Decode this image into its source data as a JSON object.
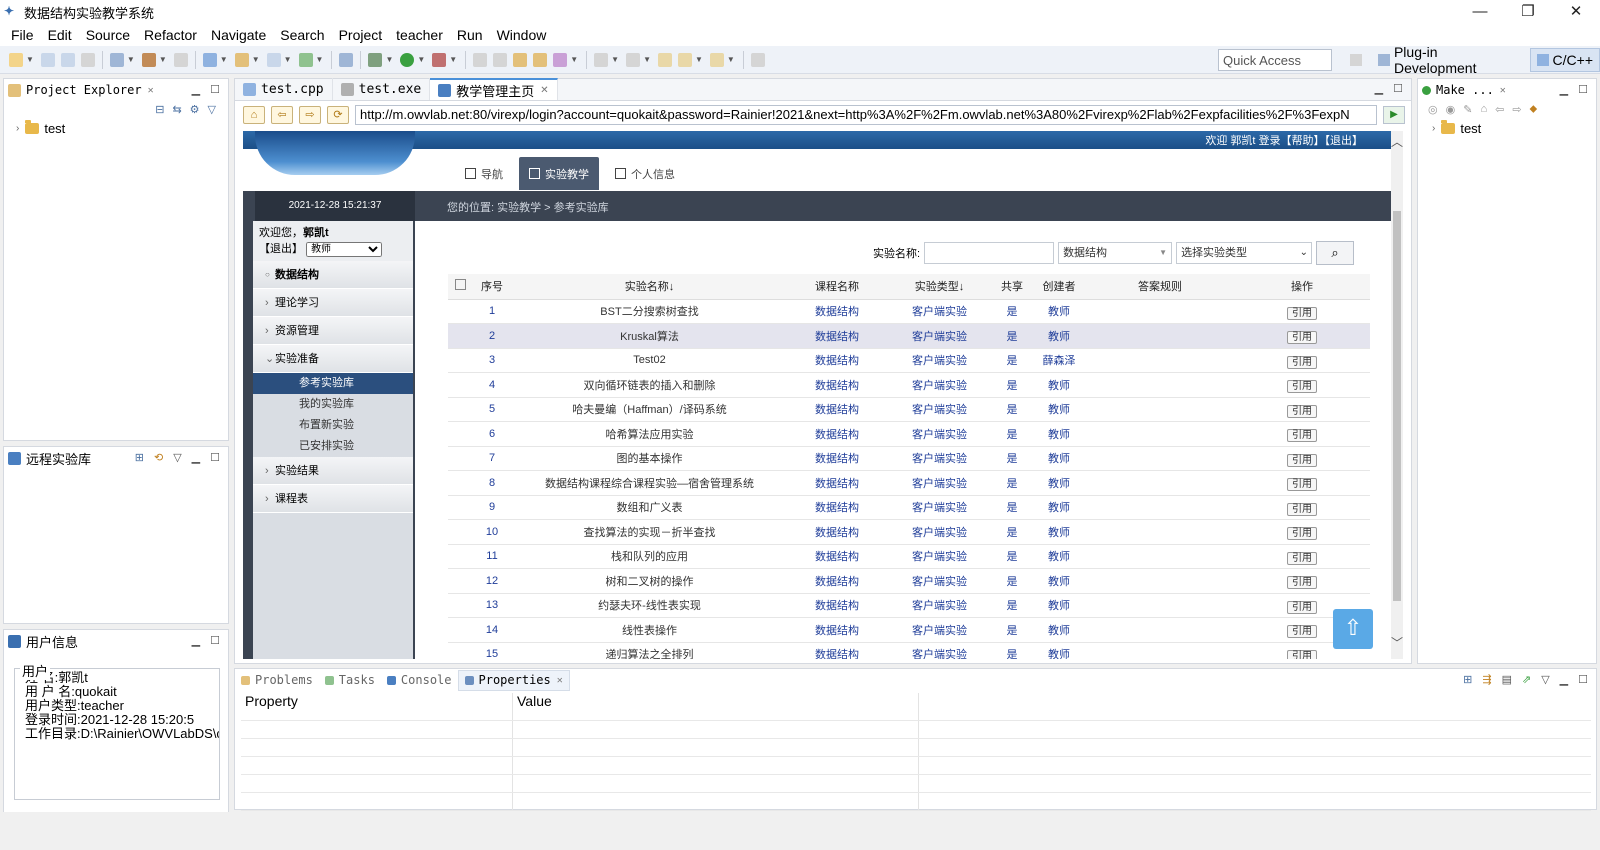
{
  "window": {
    "title": "数据结构实验教学系统",
    "controls": [
      "—",
      "❐",
      "✕"
    ]
  },
  "menu": [
    "File",
    "Edit",
    "Source",
    "Refactor",
    "Navigate",
    "Search",
    "Project",
    "teacher",
    "Run",
    "Window"
  ],
  "toolbar": {
    "quick_access_placeholder": "Quick Access",
    "perspectives": [
      "Plug-in Development",
      "C/C++"
    ]
  },
  "project_explorer": {
    "title": "Project Explorer",
    "items": [
      "test"
    ]
  },
  "remote_lib": {
    "title": "远程实验库"
  },
  "user_info": {
    "title": "用户信息",
    "group": "用户",
    "lines": [
      "姓    名:郭凯t",
      "用 户 名:quokait",
      "用户类型:teacher",
      "登录时间:2021-12-28 15:20:5",
      "工作目录:D:\\Rainier\\OWVLabDS\\c"
    ]
  },
  "editor": {
    "tabs": [
      "test.cpp",
      "test.exe",
      "教学管理主页"
    ],
    "url": "http://m.owvlab.net:80/virexp/login?account=quokait&password=Rainier!2021&next=http%3A%2F%2Fm.owvlab.net%3A80%2Fvirexp%2Flab%2Fexpfacilities%2F%3FexpN"
  },
  "web": {
    "welcome": "欢迎 郭凯t 登录【帮助】【退出】",
    "nav": [
      "导航",
      "实验教学",
      "个人信息"
    ],
    "datetime": "2021-12-28   15:21:37",
    "breadcrumb": "您的位置: 实验教学 > 参考实验库",
    "hello_text": "欢迎您，",
    "hello_name": "郭凯t",
    "logout": "【退出】",
    "role": "教师",
    "side": {
      "root": "数据结构",
      "items": [
        "理论学习",
        "资源管理",
        "实验准备"
      ],
      "subitems": [
        "参考实验库",
        "我的实验库",
        "布置新实验",
        "已安排实验"
      ],
      "after": [
        "实验结果",
        "课程表"
      ]
    },
    "search": {
      "label": "实验名称:",
      "course": "数据结构",
      "type_placeholder": "选择实验类型"
    },
    "headers": [
      "序号",
      "实验名称↓",
      "课程名称",
      "实验类型↓",
      "共享",
      "创建者",
      "答案规则",
      "操作"
    ],
    "rows": [
      [
        "1",
        "BST二分搜索树查找",
        "数据结构",
        "客户端实验",
        "是",
        "教师",
        "",
        "引用"
      ],
      [
        "2",
        "Kruskal算法",
        "数据结构",
        "客户端实验",
        "是",
        "教师",
        "",
        "引用"
      ],
      [
        "3",
        "Test02",
        "数据结构",
        "客户端实验",
        "是",
        "薛森泽",
        "",
        "引用"
      ],
      [
        "4",
        "双向循环链表的插入和删除",
        "数据结构",
        "客户端实验",
        "是",
        "教师",
        "",
        "引用"
      ],
      [
        "5",
        "哈夫曼编（Haffman）/译码系统",
        "数据结构",
        "客户端实验",
        "是",
        "教师",
        "",
        "引用"
      ],
      [
        "6",
        "哈希算法应用实验",
        "数据结构",
        "客户端实验",
        "是",
        "教师",
        "",
        "引用"
      ],
      [
        "7",
        "图的基本操作",
        "数据结构",
        "客户端实验",
        "是",
        "教师",
        "",
        "引用"
      ],
      [
        "8",
        "数据结构课程综合课程实验—宿舍管理系统",
        "数据结构",
        "客户端实验",
        "是",
        "教师",
        "",
        "引用"
      ],
      [
        "9",
        "数组和广义表",
        "数据结构",
        "客户端实验",
        "是",
        "教师",
        "",
        "引用"
      ],
      [
        "10",
        "查找算法的实现－折半查找",
        "数据结构",
        "客户端实验",
        "是",
        "教师",
        "",
        "引用"
      ],
      [
        "11",
        "栈和队列的应用",
        "数据结构",
        "客户端实验",
        "是",
        "教师",
        "",
        "引用"
      ],
      [
        "12",
        "树和二叉树的操作",
        "数据结构",
        "客户端实验",
        "是",
        "教师",
        "",
        "引用"
      ],
      [
        "13",
        "约瑟夫环-线性表实现",
        "数据结构",
        "客户端实验",
        "是",
        "教师",
        "",
        "引用"
      ],
      [
        "14",
        "线性表操作",
        "数据结构",
        "客户端实验",
        "是",
        "教师",
        "",
        "引用"
      ],
      [
        "15",
        "递归算法之全排列",
        "数据结构",
        "客户端实验",
        "是",
        "教师",
        "",
        "引用"
      ]
    ],
    "highlighted_row": 1
  },
  "make_panel": {
    "title": "Make ...",
    "items": [
      "test"
    ]
  },
  "bottom": {
    "tabs": [
      "Problems",
      "Tasks",
      "Console",
      "Properties"
    ],
    "columns": [
      "Property",
      "Value"
    ]
  }
}
